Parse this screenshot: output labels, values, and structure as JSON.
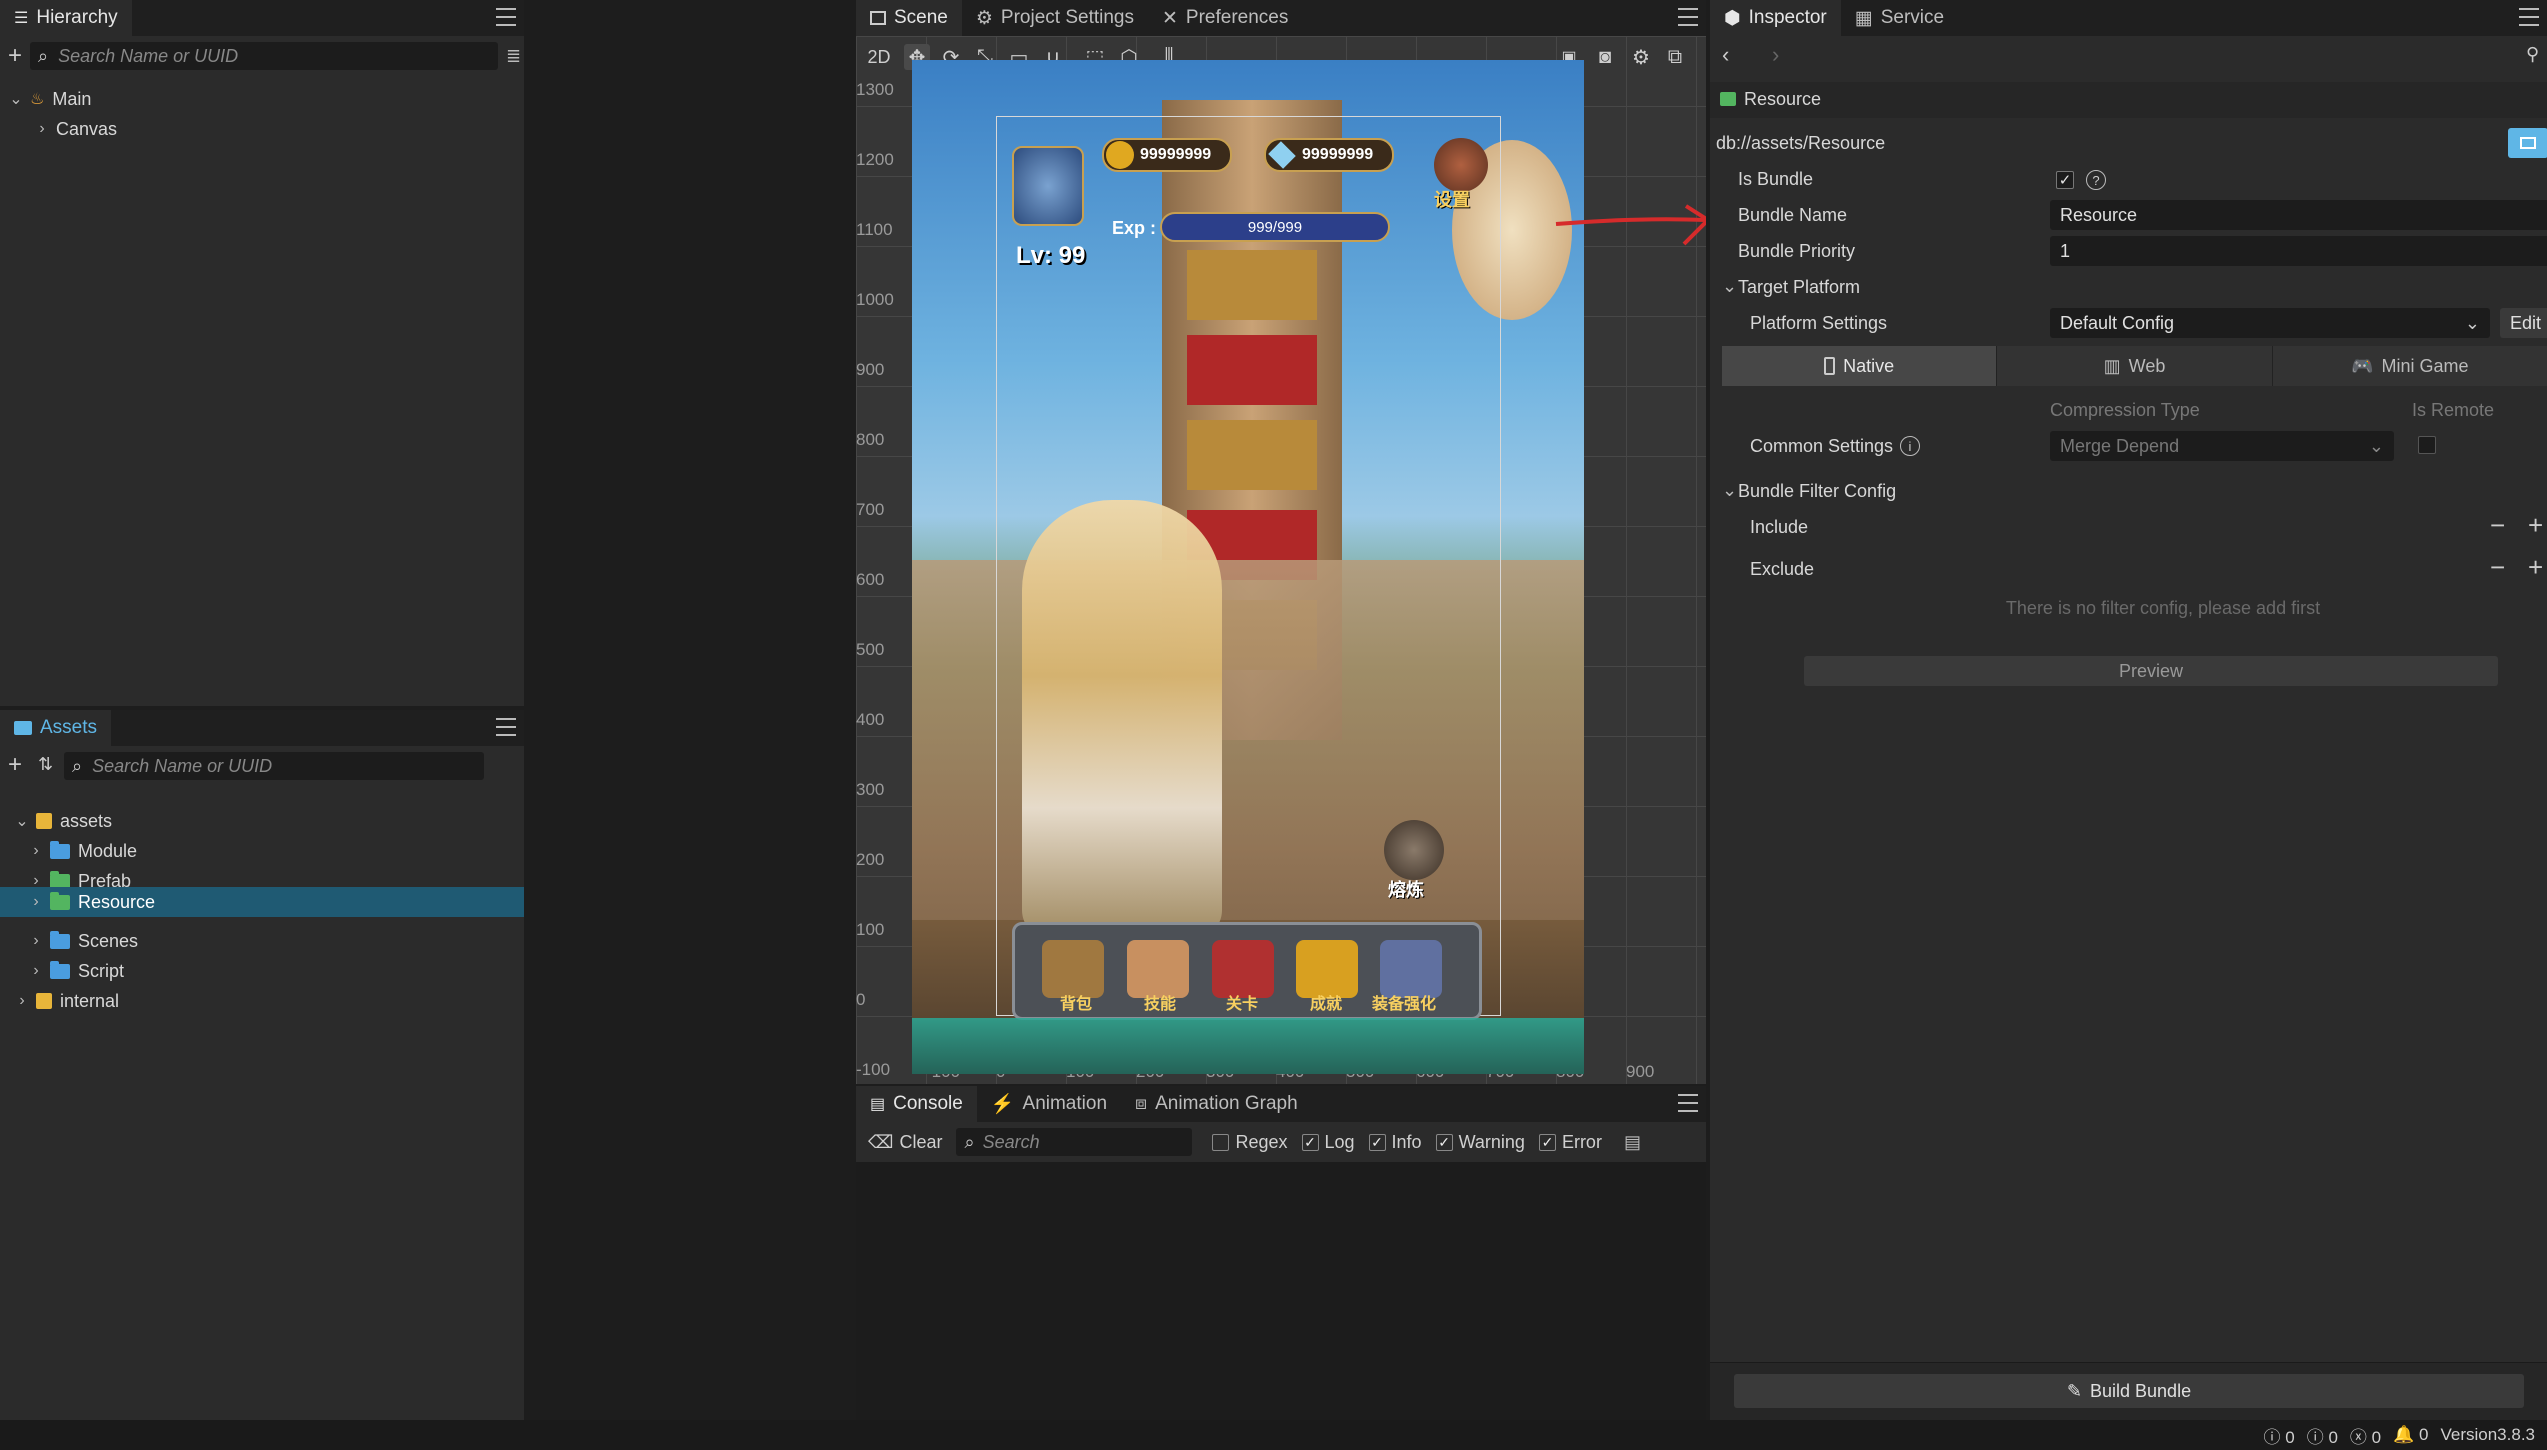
{
  "hierarchy": {
    "title": "Hierarchy",
    "search_placeholder": "Search Name or UUID",
    "nodes": [
      "Main",
      "Canvas"
    ]
  },
  "assets": {
    "title": "Assets",
    "search_placeholder": "Search Name or UUID",
    "nodes": [
      "assets",
      "Module",
      "Prefab",
      "Resource",
      "Scenes",
      "Script",
      "internal"
    ],
    "selected": "Resource"
  },
  "scene": {
    "tabs": [
      "Scene",
      "Project Settings",
      "Preferences"
    ],
    "mode_2d": "2D",
    "ruler_y": [
      "1300",
      "1200",
      "1100",
      "1000",
      "900",
      "800",
      "700",
      "600",
      "500",
      "400",
      "300",
      "200",
      "100",
      "0",
      "-100"
    ],
    "ruler_x": [
      "-100",
      "0",
      "100",
      "200",
      "300",
      "400",
      "500",
      "600",
      "700",
      "800",
      "900"
    ],
    "game": {
      "gold": "99999999",
      "diamond": "99999999",
      "exp_label": "Exp :",
      "exp_value": "999/999",
      "level": "Lv: 99",
      "settings_label": "设置",
      "forge_label": "熔炼",
      "bottom_buttons": [
        "背包",
        "技能",
        "关卡",
        "成就",
        "装备强化"
      ]
    }
  },
  "console": {
    "tabs": [
      "Console",
      "Animation",
      "Animation Graph"
    ],
    "clear": "Clear",
    "search_placeholder": "Search",
    "filters": {
      "regex": "Regex",
      "log": "Log",
      "info": "Info",
      "warning": "Warning",
      "error": "Error"
    }
  },
  "inspector": {
    "tabs": [
      "Inspector",
      "Service"
    ],
    "asset_name": "Resource",
    "path": "db://assets/Resource",
    "is_bundle_label": "Is Bundle",
    "bundle_name_label": "Bundle Name",
    "bundle_name_value": "Resource",
    "bundle_priority_label": "Bundle Priority",
    "bundle_priority_value": "1",
    "target_platform": "Target Platform",
    "platform_settings_label": "Platform Settings",
    "platform_settings_value": "Default Config",
    "edit": "Edit",
    "platform_tabs": [
      "Native",
      "Web",
      "Mini Game"
    ],
    "compression_type": "Compression Type",
    "is_remote": "Is Remote",
    "common_settings": "Common Settings",
    "common_settings_value": "Merge Depend",
    "bundle_filter_config": "Bundle Filter Config",
    "include": "Include",
    "exclude": "Exclude",
    "no_filter": "There is no filter config, please add first",
    "preview": "Preview",
    "build_bundle": "Build Bundle"
  },
  "statusbar": {
    "counts": [
      "0",
      "0",
      "0",
      "0"
    ],
    "version": "Version3.8.3"
  },
  "colors": {
    "accent": "#5fb6e6",
    "selected_row": "#1f5a73",
    "arrow": "#d62b2b",
    "panel_bg": "#2b2b2b"
  }
}
